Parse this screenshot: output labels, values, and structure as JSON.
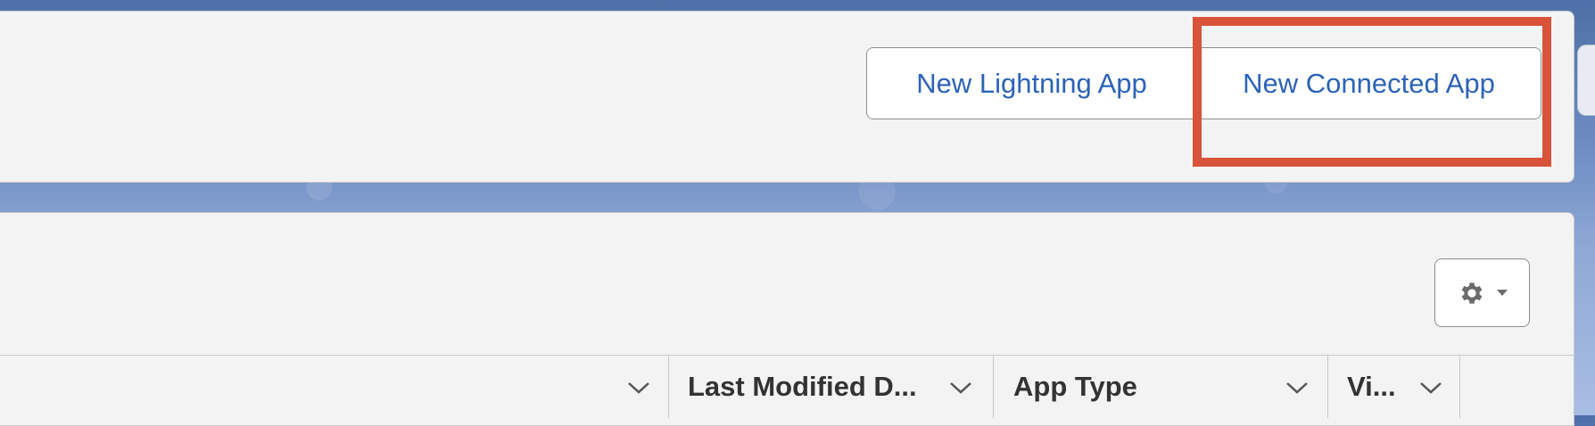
{
  "header": {
    "new_lightning_app_label": "New Lightning App",
    "new_connected_app_label": "New Connected App"
  },
  "list": {
    "settings_icon": "gear-icon",
    "columns": [
      {
        "label": ""
      },
      {
        "label": "Last Modified D..."
      },
      {
        "label": "App Type"
      },
      {
        "label": "Vi..."
      }
    ]
  },
  "colors": {
    "accent": "#2c63b8",
    "highlight": "#d9533a",
    "card_bg": "#f3f3f3"
  }
}
